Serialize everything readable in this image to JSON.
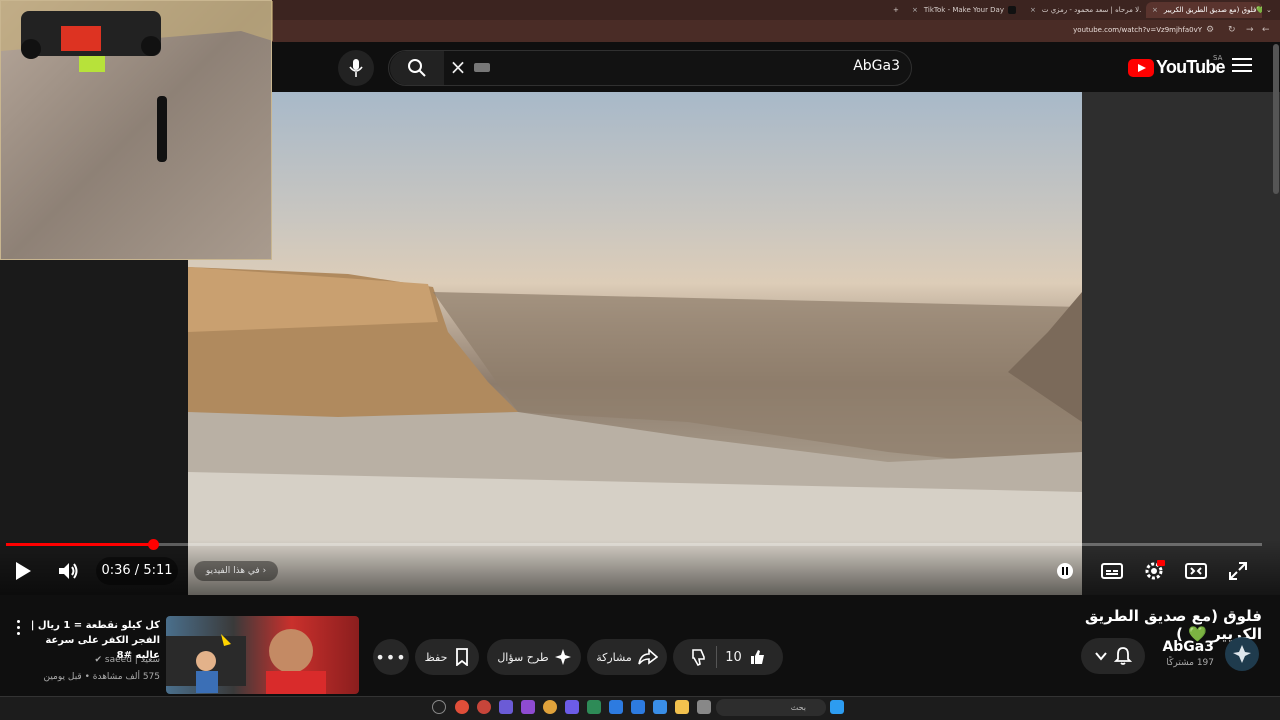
{
  "browser": {
    "tabs": [
      {
        "label": "TikTok - Make Your Day",
        "icon": "tiktok-icon"
      },
      {
        "label": "لا مرحاه | سعد محمود - رمزي ت...",
        "icon": "youtube-icon"
      },
      {
        "label": "فلوق (مع صديق الطريق الكريير💚",
        "icon": "youtube-icon",
        "active": true
      }
    ],
    "url": "youtube.com/watch?v=Vz9mjhfa0vY"
  },
  "header": {
    "search_value": "AbGa3",
    "logo_text": "YouTube",
    "region": "SA"
  },
  "player": {
    "time": "0:36 / 5:11",
    "progress_fraction": 0.117,
    "chapter_label": "في هذا الفيديو"
  },
  "video": {
    "title": "فلوق (مع صديق الطريق الكريير",
    "title_emoji": "💚",
    "title_suffix": ")",
    "channel_name": "AbGa3",
    "subscribers": "197 مشتركًا",
    "like_count": "10",
    "actions": {
      "share": "مشاركة",
      "ask": "طرح سؤال",
      "save": "حفظ"
    }
  },
  "suggestion": {
    "title": "كل كيلو نقطعة = 1 ريال | الفجر الكفر على سرعة عاليه #8",
    "channel": "سعيد | saeed",
    "meta": "575 ألف مشاهدة • قبل يومين"
  },
  "taskbar": {
    "search_placeholder": "بحث"
  },
  "colors": {
    "accent_red": "#ff0000",
    "background": "#0f0f0f",
    "pill": "#272727"
  }
}
